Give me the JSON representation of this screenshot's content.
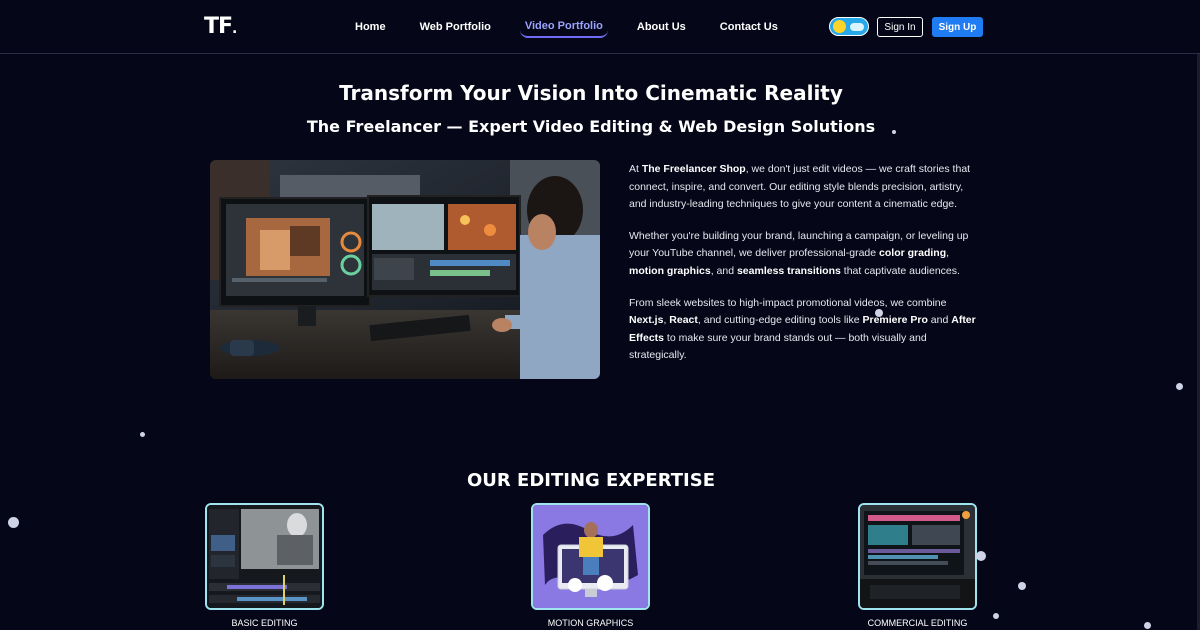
{
  "brand": {
    "logo_text": "TF",
    "logo_dot": "."
  },
  "nav": {
    "links": [
      {
        "label": "Home",
        "active": false
      },
      {
        "label": "Web Portfolio",
        "active": false
      },
      {
        "label": "Video Portfolio",
        "active": true
      },
      {
        "label": "About Us",
        "active": false
      },
      {
        "label": "Contact Us",
        "active": false
      }
    ],
    "theme_toggle": "toggle-icon",
    "signin_label": "Sign In",
    "signup_label": "Sign Up"
  },
  "hero": {
    "title": "Transform Your Vision Into Cinematic Reality",
    "subtitle": "The Freelancer — Expert Video Editing & Web Design Solutions",
    "image_icon": "video-editing-workstation-image"
  },
  "copy": {
    "p1": [
      {
        "t": "At ",
        "b": false
      },
      {
        "t": "The Freelancer Shop",
        "b": true
      },
      {
        "t": ", we don't just edit videos — we craft stories that connect, inspire, and convert. Our editing style blends precision, artistry, and industry-leading techniques to give your content a cinematic edge.",
        "b": false
      }
    ],
    "p2": [
      {
        "t": "Whether you're building your brand, launching a campaign, or leveling up your YouTube channel, we deliver professional-grade ",
        "b": false
      },
      {
        "t": "color grading",
        "b": true
      },
      {
        "t": ", ",
        "b": false
      },
      {
        "t": "motion graphics",
        "b": true
      },
      {
        "t": ", and ",
        "b": false
      },
      {
        "t": "seamless transitions",
        "b": true
      },
      {
        "t": " that captivate audiences.",
        "b": false
      }
    ],
    "p3": [
      {
        "t": "From sleek websites to high-impact promotional videos, we combine ",
        "b": false
      },
      {
        "t": "Next.js",
        "b": true
      },
      {
        "t": ", ",
        "b": false
      },
      {
        "t": "React",
        "b": true
      },
      {
        "t": ", and cutting-edge editing tools like ",
        "b": false
      },
      {
        "t": "Premiere Pro",
        "b": true
      },
      {
        "t": " and ",
        "b": false
      },
      {
        "t": "After Effects",
        "b": true
      },
      {
        "t": " to make sure your brand stands out — both visually and strategically.",
        "b": false
      }
    ]
  },
  "expertise": {
    "title": "OUR EDITING EXPERTISE",
    "cards": [
      {
        "label": "BASIC EDITING",
        "icon": "basic-editing-thumbnail"
      },
      {
        "label": "MOTION GRAPHICS",
        "icon": "motion-graphics-thumbnail"
      },
      {
        "label": "COMMERCIAL EDITING",
        "icon": "commercial-editing-thumbnail"
      }
    ]
  },
  "colors": {
    "background": "#050617",
    "accent_nav_active": "#9aa3ff",
    "signup_button": "#1f7cf2",
    "card_border": "#9fe4ee"
  }
}
